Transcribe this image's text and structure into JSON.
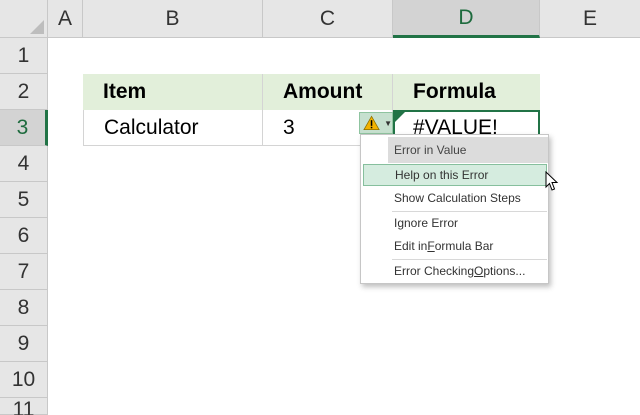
{
  "columns": [
    "A",
    "B",
    "C",
    "D",
    "E"
  ],
  "rows": [
    "1",
    "2",
    "3",
    "4",
    "5",
    "6",
    "7",
    "8",
    "9",
    "10",
    "11"
  ],
  "selected_column": "D",
  "selected_row": "3",
  "table": {
    "headers": [
      "Item",
      "Amount",
      "Formula"
    ],
    "row": [
      "Calculator",
      "3",
      "#VALUE!"
    ]
  },
  "error_button": {
    "icon": "warning-icon",
    "dropdown_icon": "dropdown-arrow-icon"
  },
  "menu": {
    "heading": "Error in Value",
    "items": [
      {
        "pre": "Help on this Error",
        "acc": "",
        "post": ""
      },
      {
        "pre": "Show Calculation Steps",
        "acc": "",
        "post": ""
      },
      {
        "pre": "Ignore Error",
        "acc": "",
        "post": ""
      },
      {
        "pre": "Edit in ",
        "acc": "F",
        "post": "ormula Bar"
      },
      {
        "pre": "Error Checking ",
        "acc": "O",
        "post": "ptions..."
      }
    ]
  },
  "colors": {
    "header_fill": "#e2efda",
    "accent_green": "#217346",
    "warning": "#f2b200"
  }
}
